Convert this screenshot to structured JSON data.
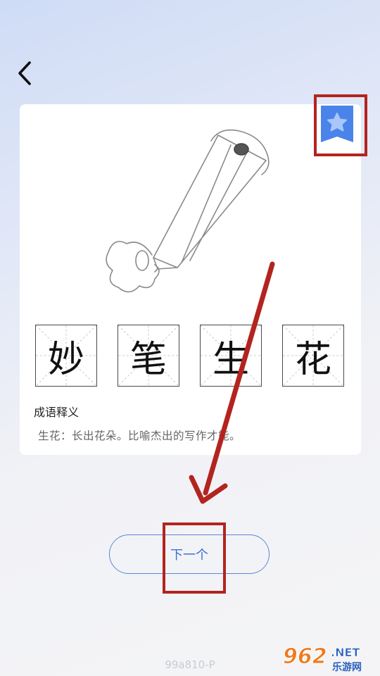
{
  "nav": {
    "back_icon": "chevron-left-icon"
  },
  "favorite": {
    "icon": "star-bookmark-icon",
    "color": "#4a84ea"
  },
  "idiom": {
    "characters": [
      "妙",
      "笔",
      "生",
      "花"
    ]
  },
  "definition": {
    "title": "成语释义",
    "text": "生花：长出花朵。比喻杰出的写作才能。"
  },
  "actions": {
    "next_label": "下一个"
  },
  "footer": {
    "page_code": "99a810-P"
  },
  "watermark": {
    "brand_number": "962",
    "brand_suffix": ".NET",
    "brand_text": "乐游网"
  },
  "colors": {
    "annotation_red": "#b3241f",
    "accent_blue": "#3b6fd1"
  }
}
